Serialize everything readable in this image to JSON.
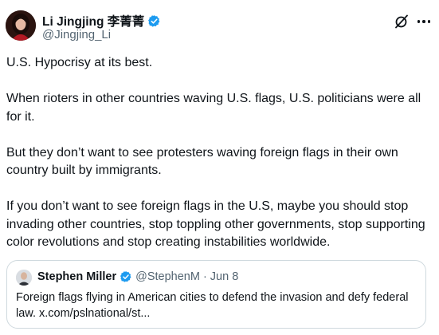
{
  "author": {
    "display_name": "Li Jingjing 李菁菁",
    "handle": "@Jingjing_Li",
    "verified_badge_color": "#1d9bf0"
  },
  "header_icons": {
    "grok": "grok-icon",
    "more": "more-icon"
  },
  "tweet": {
    "paragraphs": [
      "U.S. Hypocrisy at its best.",
      "When rioters in other countries waving U.S. flags, U.S. politicians were all for it.",
      "But they don’t want to see protesters waving foreign flags in their own country built by immigrants.",
      "If you don’t want to see foreign flags in the U.S, maybe you should stop invading other countries, stop toppling other governments, stop supporting color revolutions and stop creating instabilities worldwide."
    ]
  },
  "quoted_tweet": {
    "display_name": "Stephen Miller",
    "handle": "@StephenM",
    "separator": "·",
    "date": "Jun 8",
    "text": "Foreign flags flying in American cities to defend the invasion and defy federal law. x.com/pslnational/st..."
  },
  "colors": {
    "text_primary": "#0f1419",
    "text_secondary": "#536471",
    "border": "#cfd9de"
  }
}
